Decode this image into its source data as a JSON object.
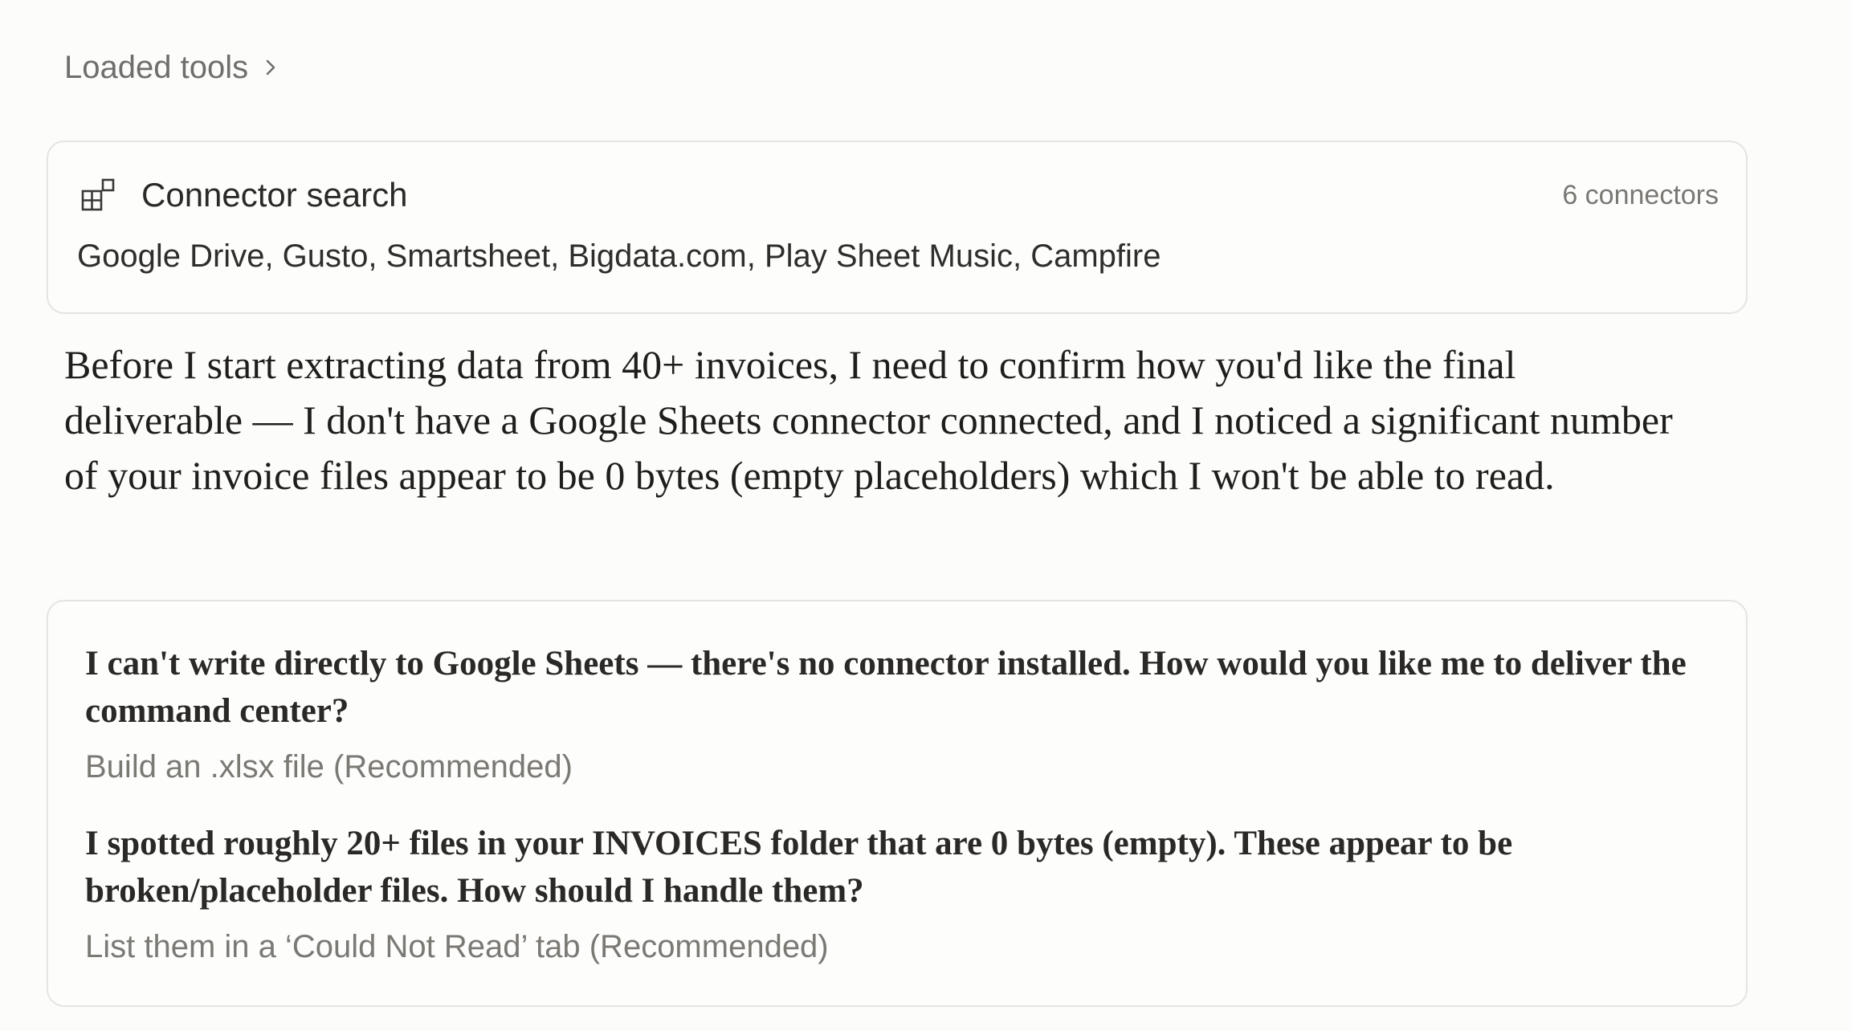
{
  "loaded_tools": {
    "label": "Loaded tools",
    "icon": "chevron-right-icon"
  },
  "connector_search": {
    "icon": "connector-icon",
    "title": "Connector search",
    "count": "6 connectors",
    "connectors": "Google Drive, Gusto, Smartsheet, Bigdata.com, Play Sheet Music, Campfire"
  },
  "assistant_message": "Before I start extracting data from 40+ invoices, I need to confirm how you'd like the final deliverable — I don't have a Google Sheets connector connected, and I noticed a significant number of your invoice files appear to be 0 bytes (empty placeholders) which I won't be able to read.",
  "questions": [
    {
      "question": "I can't write directly to Google Sheets — there's no connector installed. How would you like me to deliver the command center?",
      "answer": "Build an .xlsx file (Recommended)"
    },
    {
      "question": "I spotted roughly 20+ files in your INVOICES folder that are 0 bytes (empty). These appear to be broken/placeholder files. How should I handle them?",
      "answer": "List them in a ‘Could Not Read’ tab (Recommended)"
    }
  ]
}
